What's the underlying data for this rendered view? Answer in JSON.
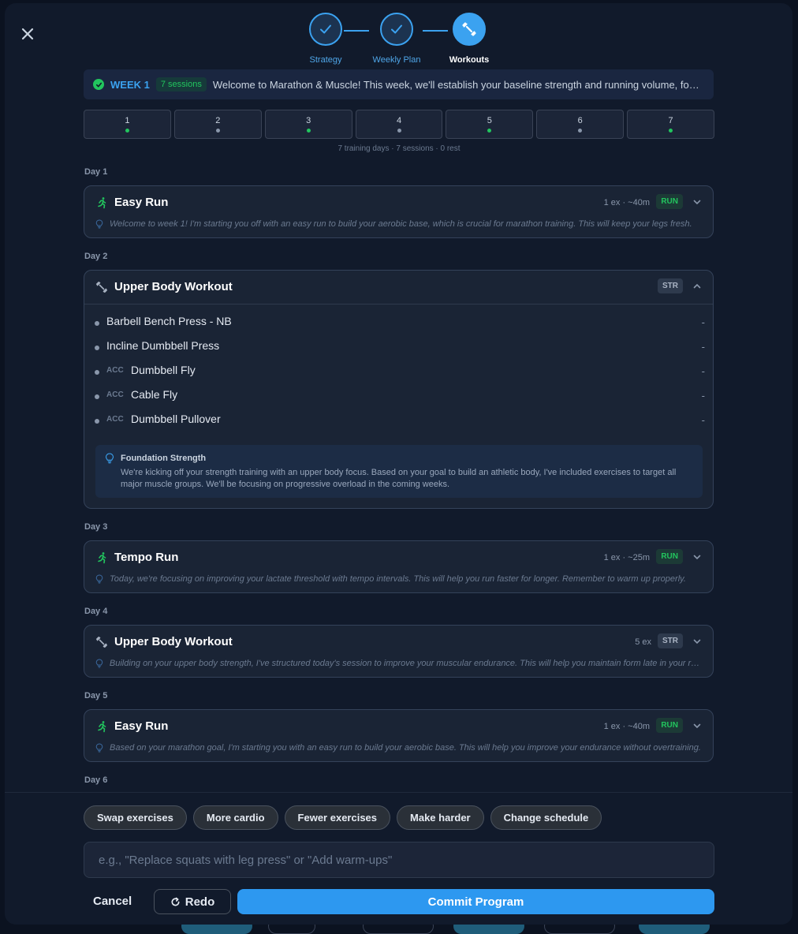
{
  "stepper": {
    "steps": [
      {
        "label": "Strategy",
        "state": "done"
      },
      {
        "label": "Weekly Plan",
        "state": "done"
      },
      {
        "label": "Workouts",
        "state": "active"
      }
    ]
  },
  "week": {
    "label": "WEEK 1",
    "sessions": "7 sessions",
    "welcome": "Welcome to Marathon & Muscle! This week, we'll establish your baseline strength and running volume, focusing on building a foundation for the weeks ahead."
  },
  "day_tabs": [
    {
      "num": "1",
      "dot": "#22c55e"
    },
    {
      "num": "2",
      "dot": "#8a97ab"
    },
    {
      "num": "3",
      "dot": "#22c55e"
    },
    {
      "num": "4",
      "dot": "#8a97ab"
    },
    {
      "num": "5",
      "dot": "#22c55e"
    },
    {
      "num": "6",
      "dot": "#8a97ab"
    },
    {
      "num": "7",
      "dot": "#22c55e"
    }
  ],
  "summary": "7 training days · 7 sessions · 0 rest",
  "days": {
    "d1": {
      "label": "Day 1",
      "title": "Easy Run",
      "meta": "1 ex · ~40m",
      "badge": "RUN",
      "note": "Welcome to week 1! I'm starting you off with an easy run to build your aerobic base, which is crucial for marathon training. This will keep your legs fresh."
    },
    "d2": {
      "label": "Day 2",
      "title": "Upper Body Workout",
      "badge": "STR",
      "exercises": [
        {
          "acc": "",
          "name": "Barbell Bench Press - NB",
          "val": "-"
        },
        {
          "acc": "",
          "name": "Incline Dumbbell Press",
          "val": "-"
        },
        {
          "acc": "ACC",
          "name": "Dumbbell Fly",
          "val": "-"
        },
        {
          "acc": "ACC",
          "name": "Cable Fly",
          "val": "-"
        },
        {
          "acc": "ACC",
          "name": "Dumbbell Pullover",
          "val": "-"
        }
      ],
      "foundation_title": "Foundation Strength",
      "foundation_text": "We're kicking off your strength training with an upper body focus. Based on your goal to build an athletic body, I've included exercises to target all major muscle groups. We'll be focusing on progressive overload in the coming weeks."
    },
    "d3": {
      "label": "Day 3",
      "title": "Tempo Run",
      "meta": "1 ex · ~25m",
      "badge": "RUN",
      "note": "Today, we're focusing on improving your lactate threshold with tempo intervals. This will help you run faster for longer. Remember to warm up properly."
    },
    "d4": {
      "label": "Day 4",
      "title": "Upper Body Workout",
      "meta": "5 ex",
      "badge": "STR",
      "note": "Building on your upper body strength, I've structured today's session to improve your muscular endurance. This will help you maintain form late in your runs."
    },
    "d5": {
      "label": "Day 5",
      "title": "Easy Run",
      "meta": "1 ex · ~40m",
      "badge": "RUN",
      "note": "Based on your marathon goal, I'm starting you with an easy run to build your aerobic base. This will help you improve your endurance without overtraining."
    },
    "d6": {
      "label": "Day 6"
    }
  },
  "chips": [
    "Swap exercises",
    "More cardio",
    "Fewer exercises",
    "Make harder",
    "Change schedule"
  ],
  "prompt": {
    "placeholder": "e.g., \"Replace squats with leg press\" or \"Add warm-ups\"",
    "value": ""
  },
  "actions": {
    "cancel": "Cancel",
    "redo": "Redo",
    "commit": "Commit Program"
  },
  "colors": {
    "accent": "#3ba2f0",
    "run_green": "#22c55e",
    "commit": "#2d98f0"
  }
}
